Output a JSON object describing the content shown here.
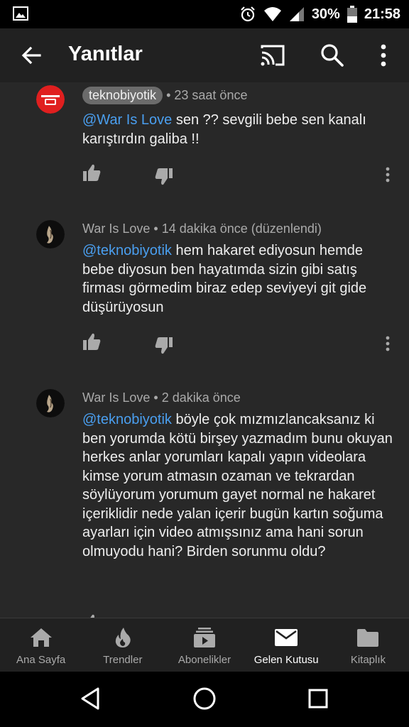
{
  "status_bar": {
    "battery_percent": "30%",
    "time": "21:58",
    "icons": [
      "image-icon",
      "alarm-icon",
      "wifi-icon",
      "signal-icon",
      "battery-icon"
    ]
  },
  "app_bar": {
    "title": "Yanıtlar",
    "icons": [
      "back-arrow-icon",
      "cast-icon",
      "search-icon",
      "more-vertical-icon"
    ]
  },
  "comments": [
    {
      "author": "teknobiyotik",
      "author_highlighted": true,
      "time": "• 23 saat önce",
      "mention": "@War Is Love",
      "text": " sen ?? sevgili bebe sen kanalı karıştırdın galiba !!"
    },
    {
      "author": "War Is Love",
      "author_highlighted": false,
      "time": "• 14 dakika önce (düzenlendi)",
      "mention": "@teknobiyotik",
      "text": " hem hakaret ediyosun hemde bebe diyosun ben hayatımda sizin gibi satış firması görmedim biraz edep seviyeyi git gide düşürüyosun"
    },
    {
      "author": "War Is Love",
      "author_highlighted": false,
      "time": "• 2 dakika önce",
      "mention": "@teknobiyotik",
      "text": " böyle çok mızmızlancaksanız ki ben yorumda kötü birşey yazmadım bunu okuyan herkes anlar yorumları kapalı yapın videolara kimse yorum atmasın ozaman ve tekrardan söylüyorum yorumum gayet normal ne hakaret içeriklidir nede yalan içerir bugün kartın soğuma ayarları için video atmışsınız ama hani sorun olmuyodu hani? Birden sorunmu oldu?"
    }
  ],
  "bottom_nav": [
    {
      "label": "Ana Sayfa",
      "icon": "home-icon",
      "active": false
    },
    {
      "label": "Trendler",
      "icon": "flame-icon",
      "active": false
    },
    {
      "label": "Abonelikler",
      "icon": "subscriptions-icon",
      "active": false
    },
    {
      "label": "Gelen Kutusu",
      "icon": "mail-icon",
      "active": true
    },
    {
      "label": "Kitaplık",
      "icon": "folder-icon",
      "active": false
    }
  ],
  "colors": {
    "background": "#282828",
    "app_bar": "#212121",
    "mention": "#4a9ff0",
    "meta_text": "#aaaaaa"
  }
}
